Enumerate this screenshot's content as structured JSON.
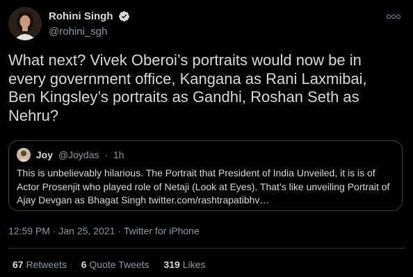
{
  "author": {
    "name": "Rohini Singh",
    "handle": "@rohini_sgh",
    "verified": true
  },
  "tweet": {
    "text": "What next? Vivek Oberoi’s portraits would now be in every government office, Kangana as Rani Laxmibai, Ben Kingsley’s portraits as Gandhi, Roshan Seth as Nehru?"
  },
  "quoted": {
    "name": "Joy",
    "handle": "@Joydas",
    "separator": "·",
    "age": "1h",
    "text": "This is unbelievably hilarious. The Portrait that President of India Unveiled, it is is of Actor Prosenjit who played role of Netaji (Look at Eyes). That’s like unveiling Portrait of Ajay Devgan as Bhagat Singh twitter.com/rashtrapatibhv…"
  },
  "meta": {
    "time": "12:59 PM",
    "separator1": "·",
    "date": "Jan 25, 2021",
    "separator2": "·",
    "source": "Twitter for iPhone"
  },
  "stats": {
    "retweets_count": "67",
    "retweets_label": "Retweets",
    "quotes_count": "6",
    "quotes_label": "Quote Tweets",
    "likes_count": "319",
    "likes_label": "Likes"
  },
  "icons": {
    "verified": "verified-badge-icon",
    "more": "more-horizontal-icon"
  },
  "colors": {
    "background": "#000000",
    "text": "#d9d9d9",
    "secondary": "#8b98a5",
    "border": "#3d4145"
  }
}
